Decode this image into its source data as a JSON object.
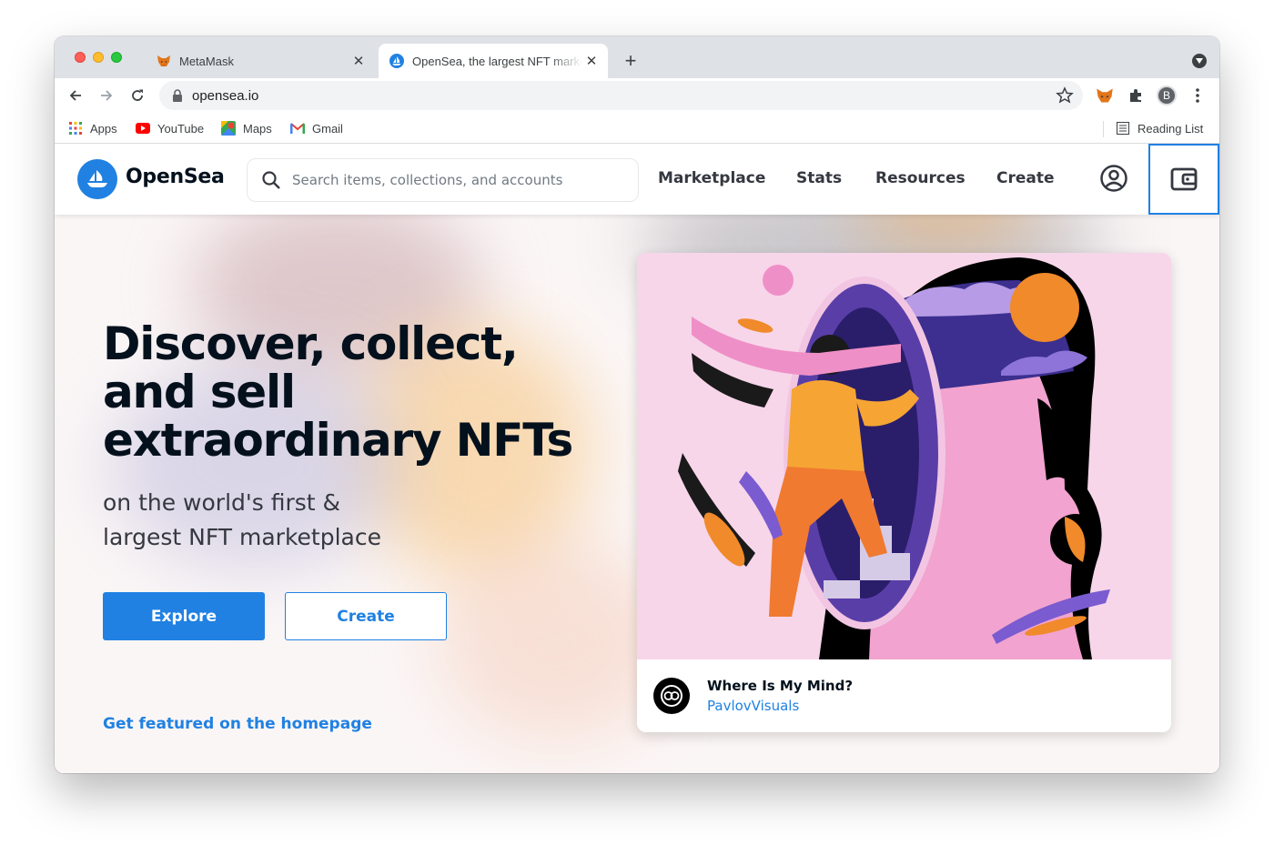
{
  "browser": {
    "tabs": [
      {
        "title": "MetaMask",
        "favicon": "metamask-fox-icon",
        "active": false
      },
      {
        "title": "OpenSea, the largest NFT marketplace",
        "favicon": "opensea-icon",
        "active": true
      }
    ],
    "new_tab": "+",
    "url": "opensea.io",
    "profile_initial": "B",
    "bookmarks": [
      {
        "label": "Apps",
        "icon": "apps-grid-icon"
      },
      {
        "label": "YouTube",
        "icon": "youtube-icon"
      },
      {
        "label": "Maps",
        "icon": "maps-icon"
      },
      {
        "label": "Gmail",
        "icon": "gmail-icon"
      }
    ],
    "reading_list": "Reading List"
  },
  "header": {
    "brand": "OpenSea",
    "search_placeholder": "Search items, collections, and accounts",
    "nav": [
      "Marketplace",
      "Stats",
      "Resources",
      "Create"
    ]
  },
  "hero": {
    "title": "Discover, collect, and sell extraordinary NFTs",
    "subtitle_line1": "on the world's first &",
    "subtitle_line2": "largest NFT marketplace",
    "explore_label": "Explore",
    "create_label": "Create",
    "featured_link": "Get featured on the homepage"
  },
  "featured_card": {
    "name": "Where Is My Mind?",
    "creator": "PavlovVisuals"
  },
  "colors": {
    "accent": "#2081e2",
    "text_dark": "#04111d",
    "tab_strip": "#dee1e6"
  }
}
